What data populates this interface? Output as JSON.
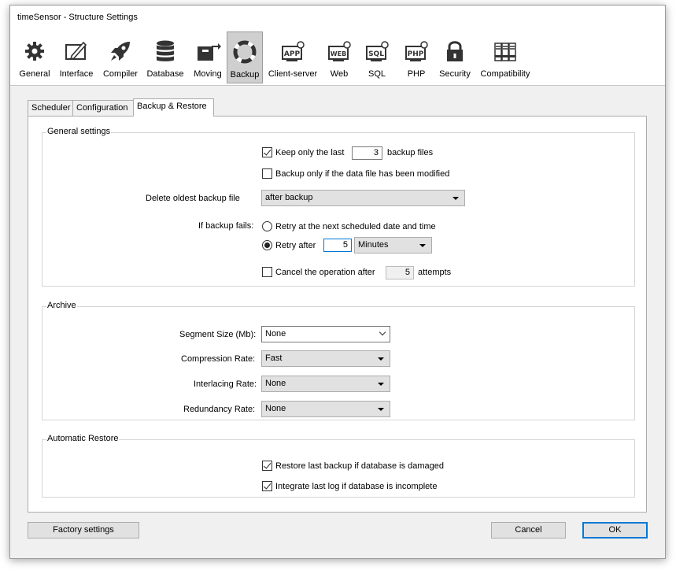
{
  "window": {
    "title": "timeSensor - Structure Settings"
  },
  "toolbar": {
    "items": [
      {
        "label": "General",
        "icon": "gear-icon",
        "active": false
      },
      {
        "label": "Interface",
        "icon": "interface-icon",
        "active": false
      },
      {
        "label": "Compiler",
        "icon": "rocket-icon",
        "active": false
      },
      {
        "label": "Database",
        "icon": "database-icon",
        "active": false
      },
      {
        "label": "Moving",
        "icon": "moving-icon",
        "active": false
      },
      {
        "label": "Backup",
        "icon": "lifebuoy-icon",
        "active": true
      },
      {
        "label": "Client-server",
        "icon": "app-server-icon",
        "icon_text": "APP",
        "active": false
      },
      {
        "label": "Web",
        "icon": "web-server-icon",
        "icon_text": "WEB",
        "active": false
      },
      {
        "label": "SQL",
        "icon": "sql-server-icon",
        "icon_text": "SQL",
        "active": false
      },
      {
        "label": "PHP",
        "icon": "php-server-icon",
        "icon_text": "PHP",
        "active": false
      },
      {
        "label": "Security",
        "icon": "lock-icon",
        "active": false
      },
      {
        "label": "Compatibility",
        "icon": "compatibility-icon",
        "active": false
      }
    ]
  },
  "tabs": [
    {
      "label": "Scheduler",
      "active": false
    },
    {
      "label": "Configuration",
      "active": false
    },
    {
      "label": "Backup & Restore",
      "active": true
    }
  ],
  "general_settings": {
    "title": "General settings",
    "keep_last": {
      "prefix": "Keep only the last",
      "value": "3",
      "suffix": "backup files",
      "checked": true
    },
    "modified_only": {
      "label": "Backup only if the data file has been modified",
      "checked": false
    },
    "delete_oldest": {
      "label": "Delete oldest backup file",
      "value": "after backup"
    },
    "if_fails": {
      "label": "If backup fails:",
      "retry_scheduled": {
        "label": "Retry at the next scheduled date and time",
        "checked": false
      },
      "retry_after": {
        "label": "Retry after",
        "value": "5",
        "unit": "Minutes",
        "checked": true
      },
      "cancel_after": {
        "prefix": "Cancel the operation after",
        "value": "5",
        "suffix": "attempts",
        "checked": false
      }
    }
  },
  "archive": {
    "title": "Archive",
    "segment_size": {
      "label": "Segment Size (Mb):",
      "value": "None"
    },
    "compression_rate": {
      "label": "Compression Rate:",
      "value": "Fast"
    },
    "interlacing_rate": {
      "label": "Interlacing Rate:",
      "value": "None"
    },
    "redundancy_rate": {
      "label": "Redundancy Rate:",
      "value": "None"
    }
  },
  "automatic_restore": {
    "title": "Automatic Restore",
    "restore_last": {
      "label": "Restore last backup if database is damaged",
      "checked": true
    },
    "integrate_log": {
      "label": "Integrate last log if database is incomplete",
      "checked": true
    }
  },
  "footer": {
    "factory": "Factory settings",
    "cancel": "Cancel",
    "ok": "OK"
  },
  "colors": {
    "accent": "#0078d7",
    "active_tab": "#cfcfcf"
  }
}
